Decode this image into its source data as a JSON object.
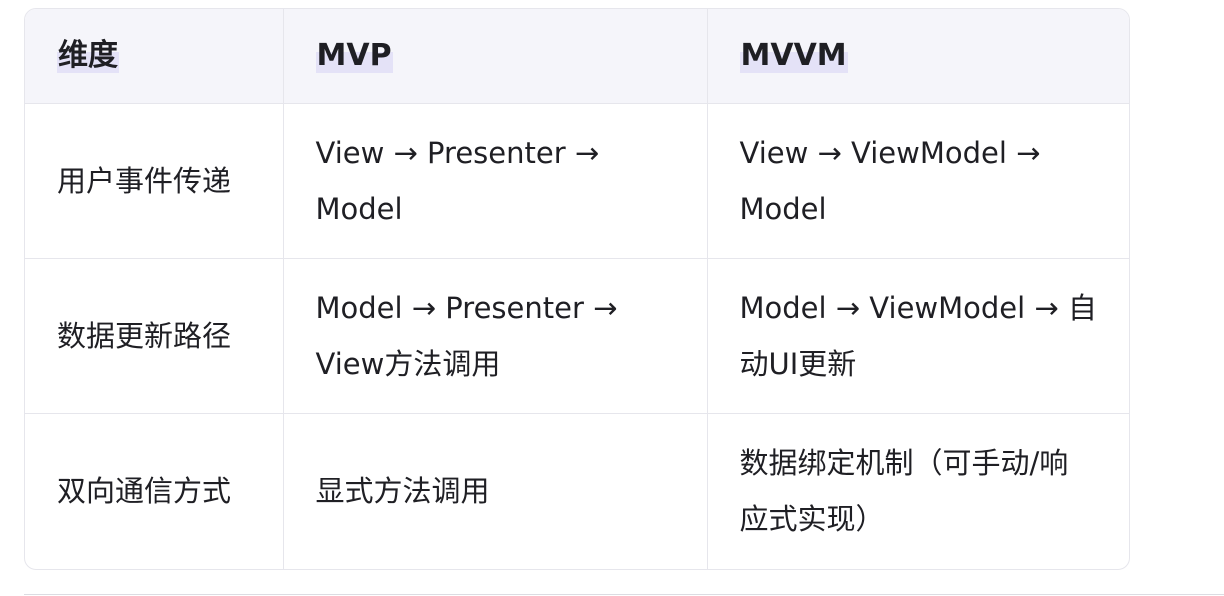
{
  "table": {
    "headers": [
      "维度",
      "MVP",
      "MVVM"
    ],
    "rows": [
      [
        "用户事件传递",
        "View → Presenter → Model",
        "View → ViewModel → Model"
      ],
      [
        "数据更新路径",
        "Model → Presenter → View方法调用",
        "Model → ViewModel → 自动UI更新"
      ],
      [
        "双向通信方式",
        "显式方法调用",
        "数据绑定机制（可手动/响应式实现）"
      ]
    ]
  }
}
